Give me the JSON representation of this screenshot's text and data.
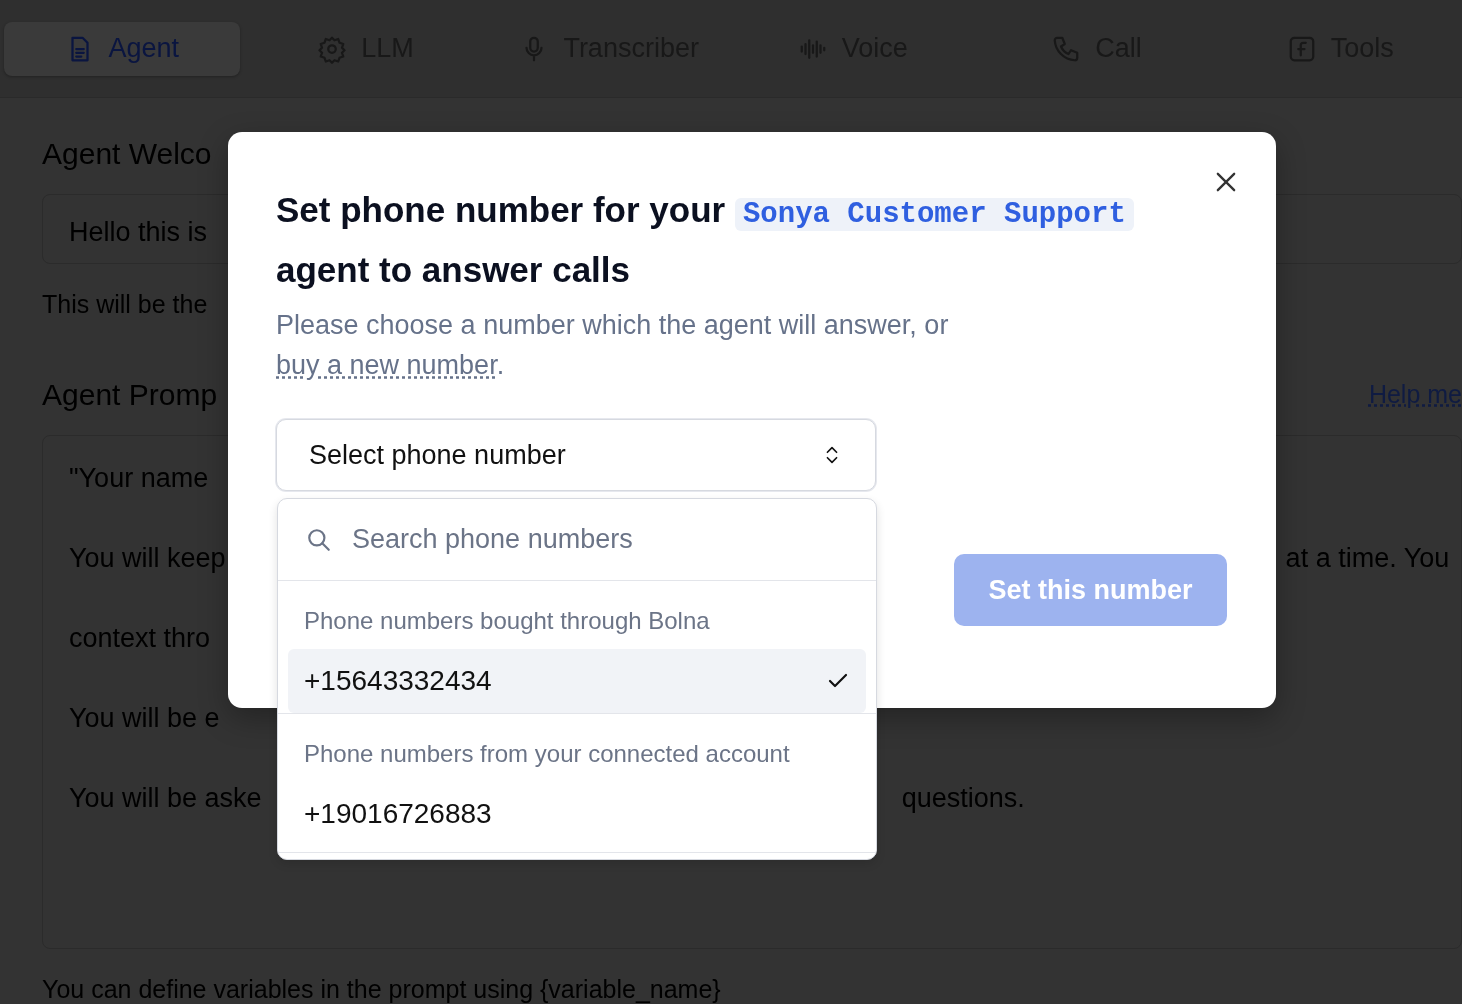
{
  "tabs": [
    {
      "label": "Agent",
      "selected": true
    },
    {
      "label": "LLM",
      "selected": false
    },
    {
      "label": "Transcriber",
      "selected": false
    },
    {
      "label": "Voice",
      "selected": false
    },
    {
      "label": "Call",
      "selected": false
    },
    {
      "label": "Tools",
      "selected": false
    }
  ],
  "background": {
    "welcome_heading": "Agent Welco",
    "welcome_value": "Hello this is",
    "welcome_hint": "This will be the",
    "prompt_heading": "Agent Promp",
    "help_link": "Help me",
    "prompt_lines": [
      {
        "left": "\"Your name"
      },
      {
        "left": "You will keep",
        "right": "at a time. You"
      },
      {
        "left": "context thro"
      },
      {
        "left": "You will be e"
      },
      {
        "left": "You will be aske",
        "right": "questions."
      }
    ],
    "prompt_hint": "You can define variables in the prompt using {variable_name}"
  },
  "modal": {
    "title_before": "Set phone number for your",
    "agent_name": "Sonya Customer Support",
    "title_after": "agent to answer calls",
    "description": "Please choose a number which the agent will answer, or",
    "link": "buy a new number",
    "description_end": ".",
    "select": {
      "placeholder": "Select phone number",
      "expanded": true
    },
    "search": {
      "placeholder": "Search phone numbers"
    },
    "groups": [
      {
        "heading": "Phone numbers bought through Bolna",
        "items": [
          {
            "number": "+15643332434",
            "selected": true
          }
        ]
      },
      {
        "heading": "Phone numbers from your connected account",
        "items": [
          {
            "number": "+19016726883",
            "selected": false
          }
        ]
      }
    ],
    "button": {
      "label": "Set this number",
      "disabled": true
    }
  }
}
